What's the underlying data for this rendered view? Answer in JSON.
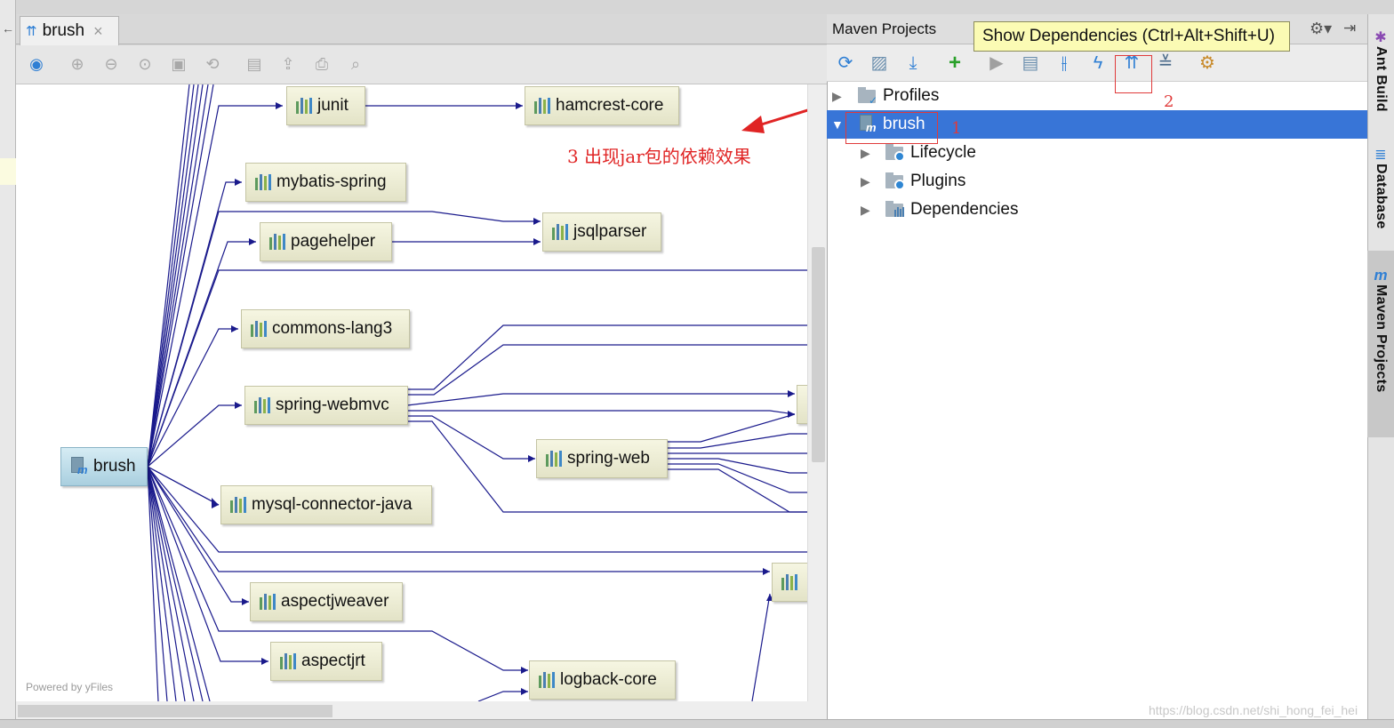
{
  "editor": {
    "tab_label": "brush",
    "tab_close": "×",
    "powered_by": "Powered by yFiles"
  },
  "graph": {
    "root": "brush",
    "nodes": {
      "junit": "junit",
      "hamcrest_core": "hamcrest-core",
      "mybatis_spring": "mybatis-spring",
      "jsqlparser": "jsqlparser",
      "pagehelper": "pagehelper",
      "commons_lang3": "commons-lang3",
      "spring_webmvc": "spring-webmvc",
      "spring_web": "spring-web",
      "mysql_connector_java": "mysql-connector-java",
      "aspectjweaver": "aspectjweaver",
      "aspectjrt": "aspectjrt",
      "logback_core": "logback-core"
    },
    "edge_color": "#1a1a8c"
  },
  "annotation": {
    "text": "3 出现jar包的依赖效果",
    "color": "#e02424"
  },
  "maven": {
    "panel_title": "Maven Projects",
    "tooltip": "Show Dependencies (Ctrl+Alt+Shift+U)",
    "tree": {
      "profiles": "Profiles",
      "project": "brush",
      "lifecycle": "Lifecycle",
      "plugins": "Plugins",
      "dependencies": "Dependencies"
    },
    "marker_1": "1",
    "marker_2": "2",
    "selected_color": "#3875d7"
  },
  "right_rail": {
    "ant_build": "Ant Build",
    "database": "Database",
    "maven_projects": "Maven Projects"
  },
  "watermark": "https://blog.csdn.net/shi_hong_fei_hei"
}
